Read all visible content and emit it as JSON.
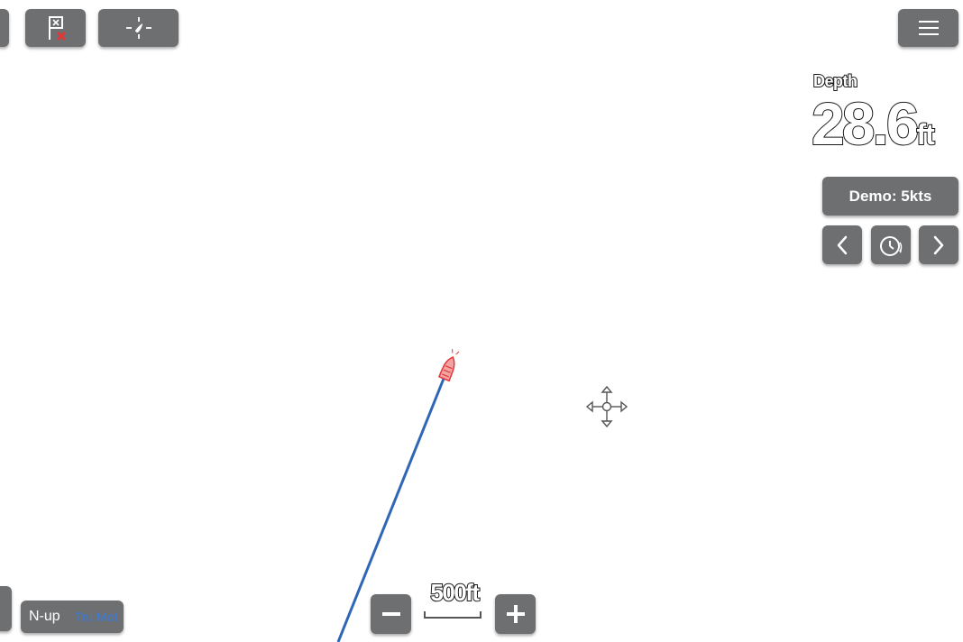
{
  "toolbar": {
    "waypoint_icon": "flag-x-icon",
    "find_ship_icon": "crosshair-icon",
    "menu_icon": "hamburger-menu-icon"
  },
  "depth": {
    "label": "Depth",
    "value": "28.6",
    "unit": "ft"
  },
  "simulator": {
    "demo_label": "Demo: 5kts",
    "prev_icon": "chevron-left-icon",
    "speed_icon": "stopwatch-icon",
    "next_icon": "chevron-right-icon"
  },
  "map": {
    "vessel_icon": "boat-icon",
    "cursor_icon": "move-cursor-icon",
    "track_color": "#2e66b8",
    "vessel_color": "#e0383a"
  },
  "scale": {
    "text": "500ft",
    "zoom_out_icon": "minus-icon",
    "zoom_in_icon": "plus-icon"
  },
  "orientation": {
    "mode": "N-up",
    "motion": "Tru Mot"
  },
  "colors": {
    "button_bg": "#6e6f71",
    "accent_blue": "#3b7bd8"
  }
}
